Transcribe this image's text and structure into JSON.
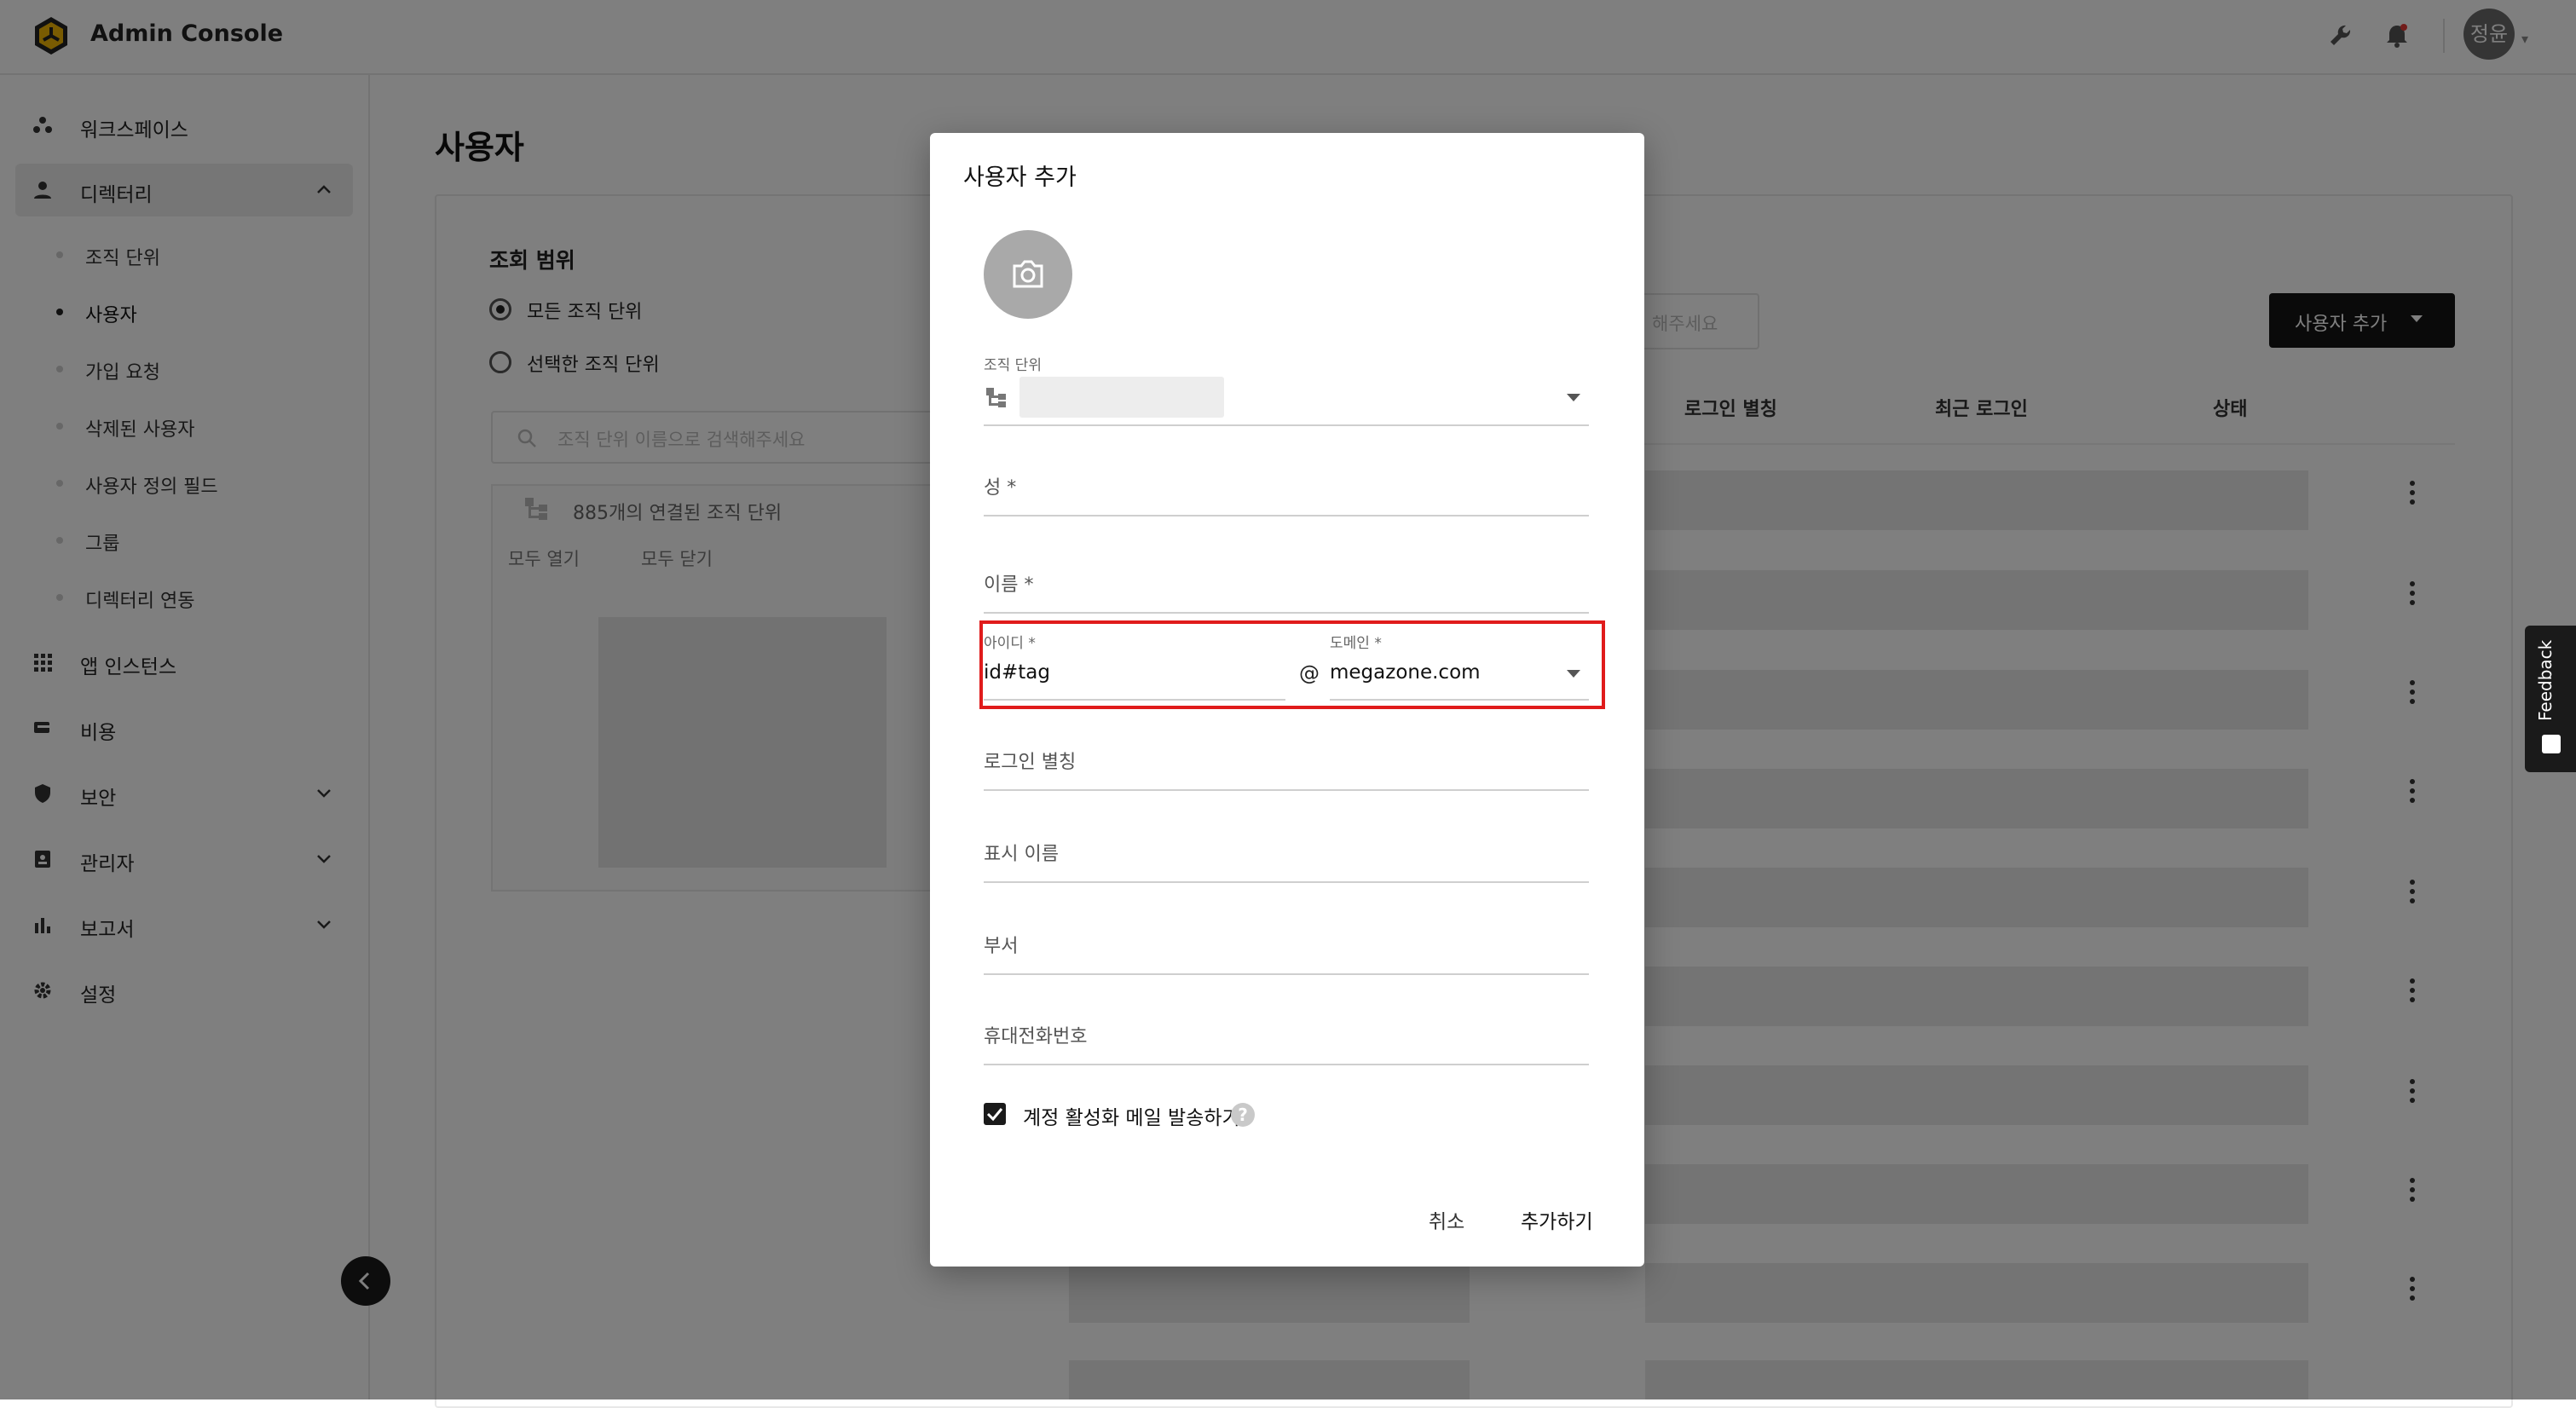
{
  "header": {
    "app_title": "Admin Console",
    "user_initials": "정윤"
  },
  "sidebar": {
    "items": [
      {
        "label": "워크스페이스"
      },
      {
        "label": "디렉터리"
      },
      {
        "label": "앱 인스턴스"
      },
      {
        "label": "비용"
      },
      {
        "label": "보안"
      },
      {
        "label": "관리자"
      },
      {
        "label": "보고서"
      },
      {
        "label": "설정"
      }
    ],
    "directory_sub": [
      {
        "label": "조직 단위"
      },
      {
        "label": "사용자"
      },
      {
        "label": "가입 요청"
      },
      {
        "label": "삭제된 사용자"
      },
      {
        "label": "사용자 정의 필드"
      },
      {
        "label": "그룹"
      },
      {
        "label": "디렉터리 연동"
      }
    ]
  },
  "main": {
    "page_title": "사용자",
    "scope": {
      "title": "조회 범위",
      "option_all": "모든 조직 단위",
      "option_selected": "선택한 조직 단위",
      "search_placeholder": "조직 단위 이름으로 검색해주세요",
      "count_text": "885개의 연결된 조직 단위",
      "expand_all": "모두 열기",
      "collapse_all": "모두 닫기"
    },
    "user_search_placeholder": "해주세요",
    "add_user_button": "사용자 추가",
    "table_headers": [
      "로그인 별칭",
      "최근 로그인",
      "상태"
    ]
  },
  "modal": {
    "title": "사용자 추가",
    "org_unit_label": "조직 단위",
    "last_name_label": "성 *",
    "first_name_label": "이름 *",
    "id_label": "아이디 *",
    "id_value": "id#tag",
    "at_sign": "@",
    "domain_label": "도메인 *",
    "domain_value": "megazone.com",
    "login_alias_label": "로그인 별칭",
    "display_name_label": "표시 이름",
    "department_label": "부서",
    "mobile_label": "휴대전화번호",
    "send_activation_label": "계정 활성화 메일 발송하기",
    "send_activation_checked": true,
    "help_glyph": "?",
    "cancel_label": "취소",
    "submit_label": "추가하기"
  },
  "feedback_label": "Feedback",
  "colors": {
    "highlight": "#e01b1b",
    "overlay": "rgba(0,0,0,0.5)",
    "primary_dark": "#151515"
  }
}
